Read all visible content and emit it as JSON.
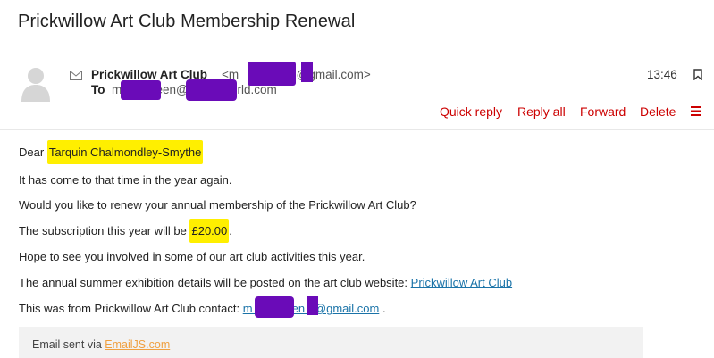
{
  "subject": "Prickwillow Art Club Membership Renewal",
  "header": {
    "sender_name": "Prickwillow Art Club",
    "sender_email": "<m        reen  @gmail.com>",
    "to_label": "To",
    "to_email": "m       green@          world.com",
    "time": "13:46"
  },
  "actions": {
    "quick_reply": "Quick reply",
    "reply_all": "Reply all",
    "forward": "Forward",
    "delete": "Delete"
  },
  "body": {
    "greeting": "Dear",
    "recipient_name": "Tarquin Chalmondley-Smythe",
    "line1": "It has come to that time in the year again.",
    "line2": "Would you like to renew your annual membership of the Prickwillow Art Club?",
    "line3_prefix": "The subscription this year will be",
    "line3_amount": "£20.00",
    "line3_suffix": ".",
    "line4": "Hope to see you involved in some of our art club activities this year.",
    "line5_prefix": "The annual summer exhibition details will be posted on the art club website:",
    "line5_link": "Prickwillow Art Club",
    "line6_prefix": "This was from Prickwillow Art Club contact:",
    "line6_email": "m         reen   @gmail.com",
    "line6_suffix": "."
  },
  "footer": {
    "text": "Email sent via",
    "link": "EmailJS.com"
  },
  "colors": {
    "action_red": "#cc0000",
    "highlight_yellow": "#ffef00",
    "redaction_purple": "#6a0bb8",
    "link_blue": "#1a73a8",
    "footer_link_orange": "#f0a040"
  },
  "icons": {
    "avatar": "user-avatar-icon",
    "mail": "envelope-icon",
    "bookmark": "bookmark-icon",
    "menu": "hamburger-menu-icon"
  }
}
